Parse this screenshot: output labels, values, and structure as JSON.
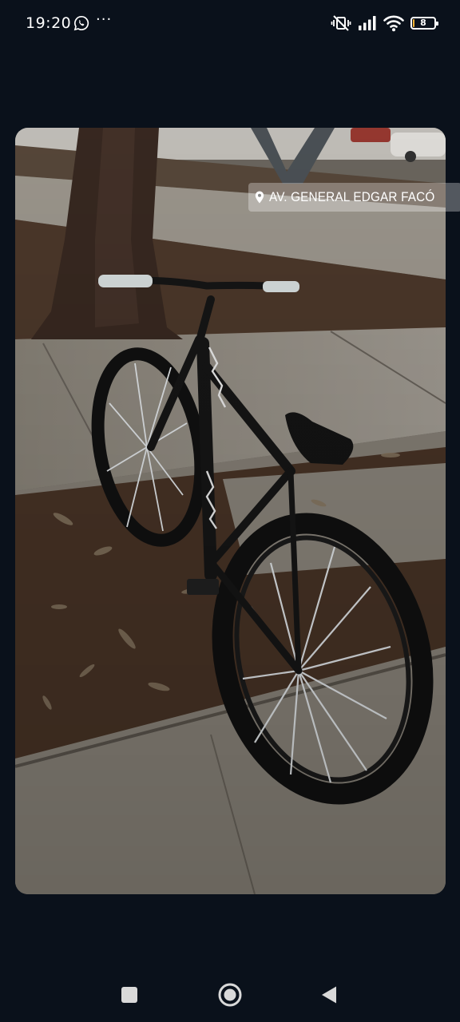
{
  "status_bar": {
    "time": "19:20",
    "notification_icons": [
      "whatsapp-icon",
      "more-dots-icon"
    ],
    "more_indicator": "···",
    "system_icons": [
      "vibrate-off-icon",
      "signal-icon",
      "wifi-icon",
      "battery-icon"
    ],
    "battery_level": "8",
    "battery_fraction": 0.08,
    "battery_color": "#f2b233"
  },
  "story": {
    "location_sticker": {
      "icon": "location-pin-icon",
      "text": "AV. GENERAL EDGAR FACÓ"
    }
  },
  "navigation_bar": {
    "buttons": [
      "recents-square-icon",
      "home-circle-icon",
      "back-triangle-icon"
    ]
  },
  "colors": {
    "background": "#0a111b",
    "icon": "#ffffff"
  }
}
